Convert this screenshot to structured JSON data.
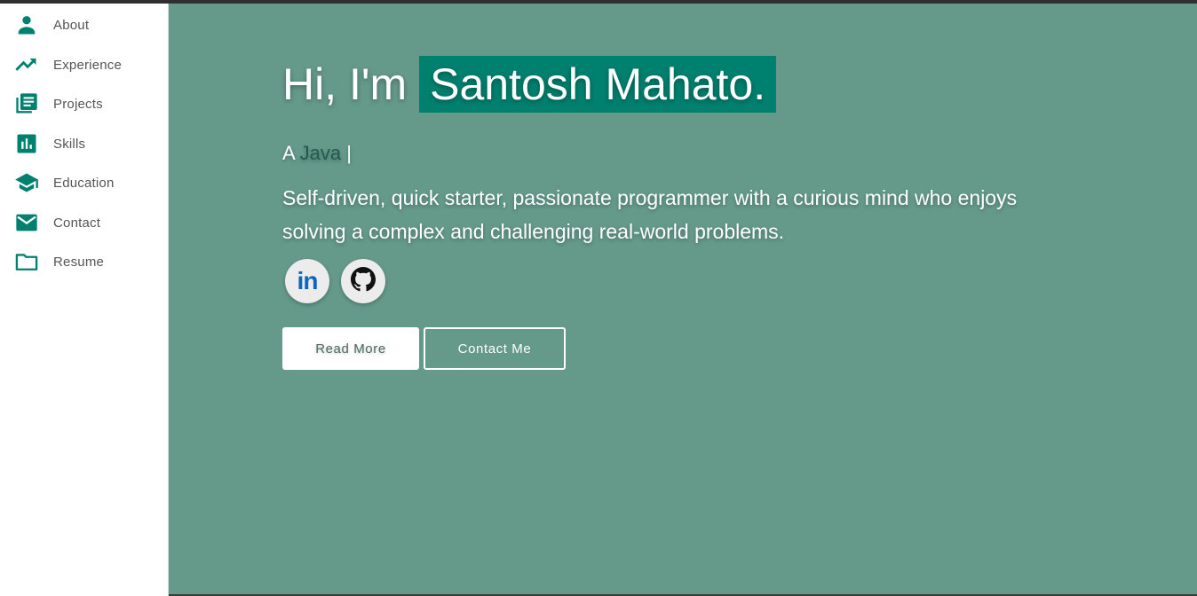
{
  "sidebar": {
    "items": [
      {
        "label": "About",
        "icon": "person-icon"
      },
      {
        "label": "Experience",
        "icon": "trending-up-icon"
      },
      {
        "label": "Projects",
        "icon": "library-books-icon"
      },
      {
        "label": "Skills",
        "icon": "bar-chart-icon"
      },
      {
        "label": "Education",
        "icon": "school-icon"
      },
      {
        "label": "Contact",
        "icon": "mail-icon"
      },
      {
        "label": "Resume",
        "icon": "folder-icon"
      }
    ]
  },
  "hero": {
    "greeting": "Hi, I'm",
    "name": "Santosh Mahato.",
    "role_prefix": "A",
    "role": "Java",
    "cursor": "|",
    "bio": "Self-driven, quick starter, passionate programmer with a curious mind who enjoys solving a complex and challenging real-world problems."
  },
  "social": {
    "linkedin_label": "in",
    "linkedin_icon": "linkedin-icon",
    "github_icon": "github-icon"
  },
  "buttons": {
    "read_more": "Read More",
    "contact_me": "Contact Me"
  },
  "colors": {
    "accent": "#00806f",
    "main_background": "#659a8b",
    "sidebar_background": "#ffffff",
    "role_text": "#1f5c50",
    "linkedin_blue": "#0a66c2"
  }
}
